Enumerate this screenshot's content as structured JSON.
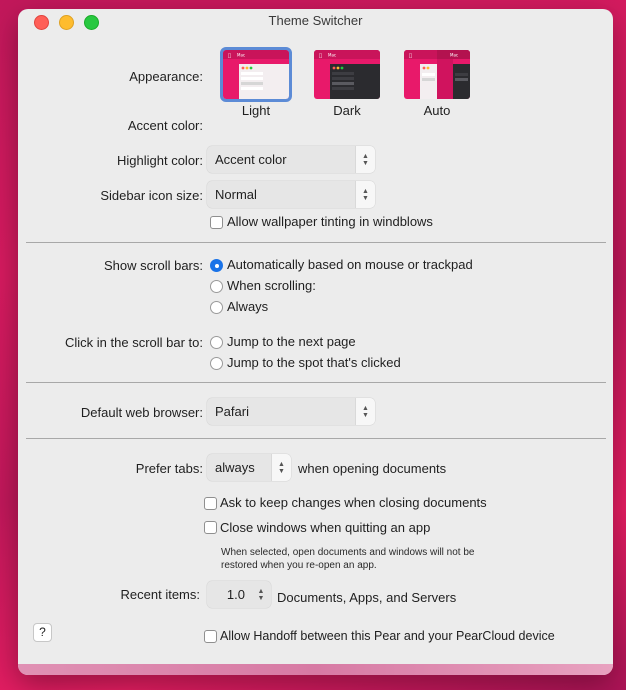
{
  "window": {
    "title": "Theme Switcher"
  },
  "appearance": {
    "label": "Appearance:",
    "options": [
      {
        "caption": "Light",
        "selected": true
      },
      {
        "caption": "Dark",
        "selected": false
      },
      {
        "caption": "Auto",
        "selected": false
      }
    ],
    "thumb_menu_text": "Mac"
  },
  "accent": {
    "label": "Accent color:"
  },
  "highlight": {
    "label": "Highlight color:",
    "value": "Accent color"
  },
  "sidebar_icon": {
    "label": "Sidebar icon size:",
    "value": "Normal"
  },
  "wallpaper_tint": {
    "label": "Allow wallpaper tinting in windblows",
    "checked": false
  },
  "scroll_bars": {
    "label": "Show scroll bars:",
    "options": [
      {
        "label": "Automatically based on mouse or trackpad",
        "selected": true
      },
      {
        "label": "When scrolling:",
        "selected": false
      },
      {
        "label": "Always",
        "selected": false
      }
    ]
  },
  "click_scroll": {
    "label": "Click in the scroll bar to:",
    "options": [
      {
        "label": "Jump to the next page",
        "selected": false
      },
      {
        "label": "Jump to the spot that's clicked",
        "selected": false
      }
    ]
  },
  "browser": {
    "label": "Default web browser:",
    "value": "Pafari"
  },
  "prefer_tabs": {
    "label": "Prefer tabs:",
    "value": "always",
    "suffix": "when opening documents"
  },
  "ask_keep": {
    "label": "Ask to keep changes when closing documents",
    "checked": false
  },
  "close_windows": {
    "label": "Close windows when quitting an app",
    "checked": false,
    "note_line1": "When selected, open documents and windows will not be",
    "note_line2": "restored when you re-open an app."
  },
  "recent": {
    "label": "Recent items:",
    "value": "1.0",
    "suffix": "Documents, Apps, and Servers"
  },
  "handoff": {
    "label": "Allow Handoff between this Pear and your PearCloud device",
    "checked": false
  },
  "help": {
    "label": "?"
  },
  "colors": {
    "accent": "#1a73e8",
    "wallpaper": "#d81b60"
  }
}
